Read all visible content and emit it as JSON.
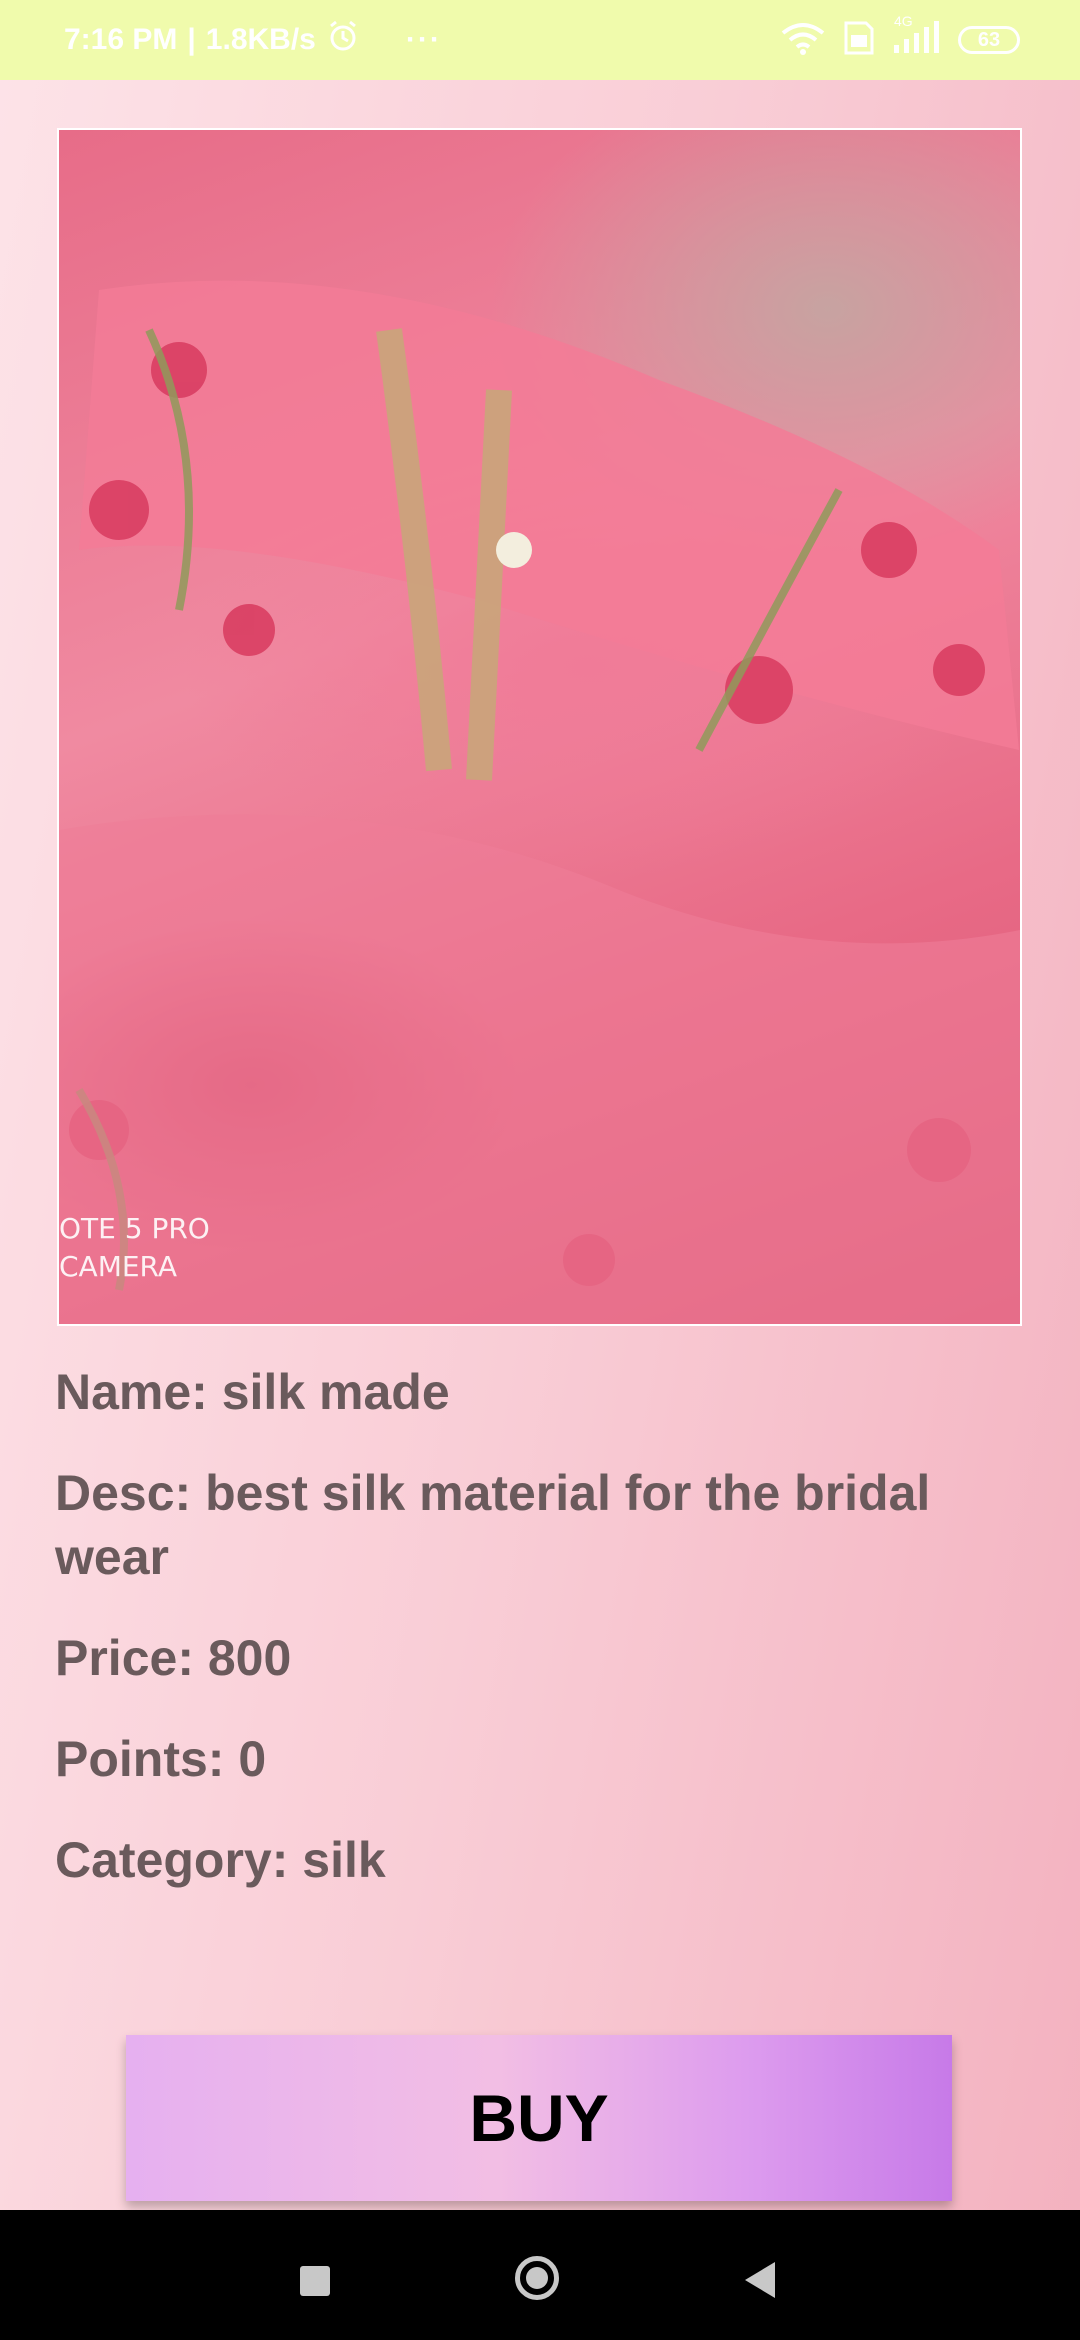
{
  "status_bar": {
    "time": "7:16 PM",
    "separator": "|",
    "speed": "1.8KB/s",
    "overflow": "···",
    "network_label": "4G",
    "battery": "63",
    "icons": [
      "alarm-icon",
      "wifi-icon",
      "sim-icon",
      "signal-icon",
      "battery-icon"
    ]
  },
  "product": {
    "image_alt": "pink embroidered silk fabric",
    "image_watermark_line1": "OTE 5 PRO",
    "image_watermark_line2": "CAMERA",
    "name": "Name: silk made",
    "desc": "Desc: best silk material for the bridal wear",
    "price": "Price: 800",
    "points": "Points: 0",
    "category": "Category: silk"
  },
  "buy_button": {
    "label": "BUY"
  },
  "nav": {
    "icons": [
      "recents-square-icon",
      "home-circle-icon",
      "back-triangle-icon"
    ]
  }
}
